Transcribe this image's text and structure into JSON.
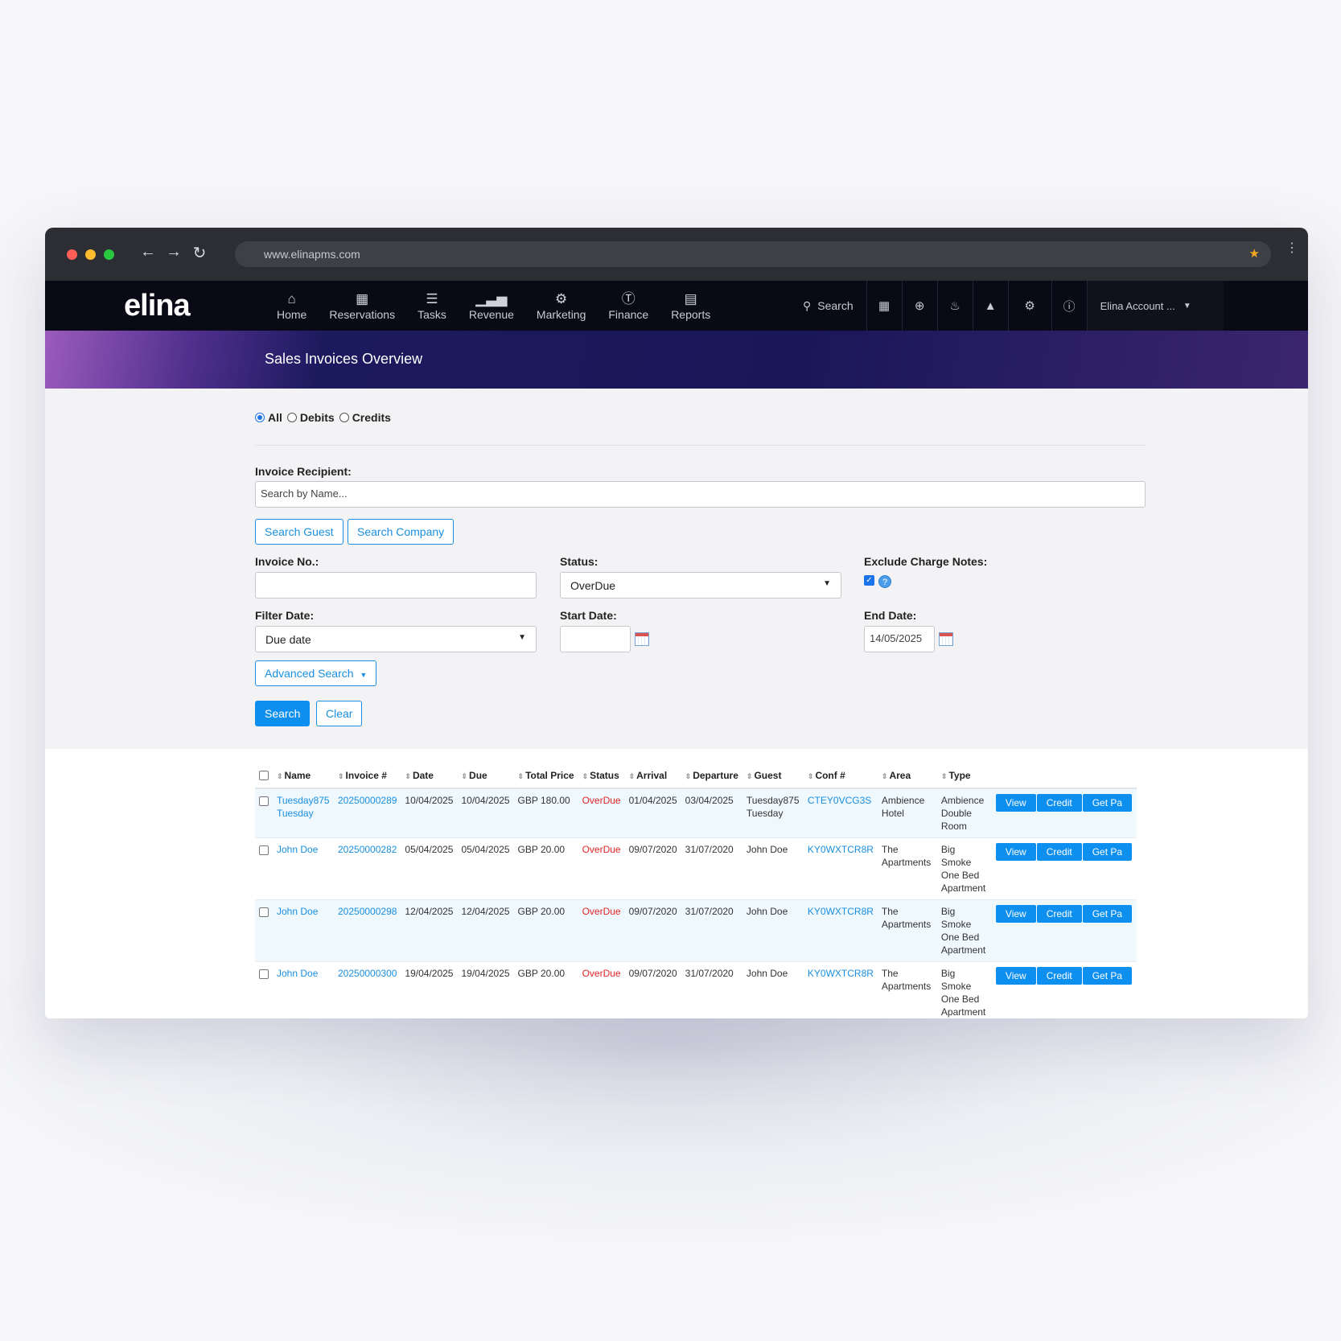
{
  "browser": {
    "url": "www.elinapms.com",
    "dot_colors": [
      "#ff5f57",
      "#febc2e",
      "#28c840"
    ]
  },
  "nav": {
    "logo": "elina",
    "items": [
      {
        "label": "Home",
        "icon": "home-icon"
      },
      {
        "label": "Reservations",
        "icon": "calendar-icon"
      },
      {
        "label": "Tasks",
        "icon": "tasks-icon"
      },
      {
        "label": "Revenue",
        "icon": "revenue-icon"
      },
      {
        "label": "Marketing",
        "icon": "marketing-icon"
      },
      {
        "label": "Finance",
        "icon": "dollar-icon"
      },
      {
        "label": "Reports",
        "icon": "report-icon"
      }
    ],
    "search_label": "Search",
    "account_label": "Elina Account ..."
  },
  "page": {
    "title": "Sales Invoices Overview"
  },
  "filters": {
    "radio_options": [
      "All",
      "Debits",
      "Credits"
    ],
    "radio_selected": "All",
    "recipient_label": "Invoice Recipient:",
    "recipient_placeholder": "Search by Name...",
    "search_guest": "Search Guest",
    "search_company": "Search Company",
    "invoice_no_label": "Invoice No.:",
    "invoice_no_value": "",
    "status_label": "Status:",
    "status_value": "OverDue",
    "exclude_label": "Exclude Charge Notes:",
    "exclude_checked": true,
    "filter_date_label": "Filter Date:",
    "filter_date_value": "Due date",
    "start_date_label": "Start Date:",
    "start_date_value": "",
    "end_date_label": "End Date:",
    "end_date_value": "14/05/2025",
    "advanced_search": "Advanced Search",
    "search_button": "Search",
    "clear_button": "Clear"
  },
  "table": {
    "columns": [
      "Name",
      "Invoice #",
      "Date",
      "Due",
      "Total Price",
      "Status",
      "Arrival",
      "Departure",
      "Guest",
      "Conf #",
      "Area",
      "Type"
    ],
    "action_labels": [
      "View",
      "Credit",
      "Get Pa"
    ],
    "rows": [
      {
        "name": "Tuesday875 Tuesday",
        "invoice": "20250000289",
        "date": "10/04/2025",
        "due": "10/04/2025",
        "total": "GBP 180.00",
        "status": "OverDue",
        "arrival": "01/04/2025",
        "departure": "03/04/2025",
        "guest": "Tuesday875 Tuesday",
        "conf": "CTEY0VCG3S",
        "area": "Ambience Hotel",
        "type": "Ambience Double Room"
      },
      {
        "name": "John Doe",
        "invoice": "20250000282",
        "date": "05/04/2025",
        "due": "05/04/2025",
        "total": "GBP 20.00",
        "status": "OverDue",
        "arrival": "09/07/2020",
        "departure": "31/07/2020",
        "guest": "John Doe",
        "conf": "KY0WXTCR8R",
        "area": "The Apartments",
        "type": "Big Smoke One Bed Apartment"
      },
      {
        "name": "John Doe",
        "invoice": "20250000298",
        "date": "12/04/2025",
        "due": "12/04/2025",
        "total": "GBP 20.00",
        "status": "OverDue",
        "arrival": "09/07/2020",
        "departure": "31/07/2020",
        "guest": "John Doe",
        "conf": "KY0WXTCR8R",
        "area": "The Apartments",
        "type": "Big Smoke One Bed Apartment"
      },
      {
        "name": "John Doe",
        "invoice": "20250000300",
        "date": "19/04/2025",
        "due": "19/04/2025",
        "total": "GBP 20.00",
        "status": "OverDue",
        "arrival": "09/07/2020",
        "departure": "31/07/2020",
        "guest": "John Doe",
        "conf": "KY0WXTCR8R",
        "area": "The Apartments",
        "type": "Big Smoke One Bed Apartment"
      }
    ]
  }
}
